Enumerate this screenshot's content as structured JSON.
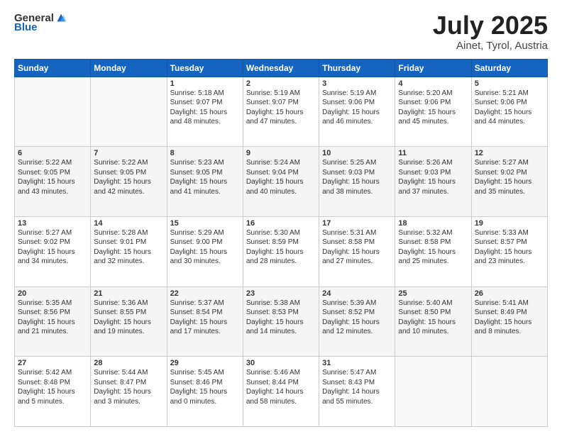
{
  "header": {
    "logo_general": "General",
    "logo_blue": "Blue",
    "title": "July 2025",
    "location": "Ainet, Tyrol, Austria"
  },
  "days_of_week": [
    "Sunday",
    "Monday",
    "Tuesday",
    "Wednesday",
    "Thursday",
    "Friday",
    "Saturday"
  ],
  "weeks": [
    [
      {
        "day": "",
        "info": ""
      },
      {
        "day": "",
        "info": ""
      },
      {
        "day": "1",
        "info": "Sunrise: 5:18 AM\nSunset: 9:07 PM\nDaylight: 15 hours\nand 48 minutes."
      },
      {
        "day": "2",
        "info": "Sunrise: 5:19 AM\nSunset: 9:07 PM\nDaylight: 15 hours\nand 47 minutes."
      },
      {
        "day": "3",
        "info": "Sunrise: 5:19 AM\nSunset: 9:06 PM\nDaylight: 15 hours\nand 46 minutes."
      },
      {
        "day": "4",
        "info": "Sunrise: 5:20 AM\nSunset: 9:06 PM\nDaylight: 15 hours\nand 45 minutes."
      },
      {
        "day": "5",
        "info": "Sunrise: 5:21 AM\nSunset: 9:06 PM\nDaylight: 15 hours\nand 44 minutes."
      }
    ],
    [
      {
        "day": "6",
        "info": "Sunrise: 5:22 AM\nSunset: 9:05 PM\nDaylight: 15 hours\nand 43 minutes."
      },
      {
        "day": "7",
        "info": "Sunrise: 5:22 AM\nSunset: 9:05 PM\nDaylight: 15 hours\nand 42 minutes."
      },
      {
        "day": "8",
        "info": "Sunrise: 5:23 AM\nSunset: 9:05 PM\nDaylight: 15 hours\nand 41 minutes."
      },
      {
        "day": "9",
        "info": "Sunrise: 5:24 AM\nSunset: 9:04 PM\nDaylight: 15 hours\nand 40 minutes."
      },
      {
        "day": "10",
        "info": "Sunrise: 5:25 AM\nSunset: 9:03 PM\nDaylight: 15 hours\nand 38 minutes."
      },
      {
        "day": "11",
        "info": "Sunrise: 5:26 AM\nSunset: 9:03 PM\nDaylight: 15 hours\nand 37 minutes."
      },
      {
        "day": "12",
        "info": "Sunrise: 5:27 AM\nSunset: 9:02 PM\nDaylight: 15 hours\nand 35 minutes."
      }
    ],
    [
      {
        "day": "13",
        "info": "Sunrise: 5:27 AM\nSunset: 9:02 PM\nDaylight: 15 hours\nand 34 minutes."
      },
      {
        "day": "14",
        "info": "Sunrise: 5:28 AM\nSunset: 9:01 PM\nDaylight: 15 hours\nand 32 minutes."
      },
      {
        "day": "15",
        "info": "Sunrise: 5:29 AM\nSunset: 9:00 PM\nDaylight: 15 hours\nand 30 minutes."
      },
      {
        "day": "16",
        "info": "Sunrise: 5:30 AM\nSunset: 8:59 PM\nDaylight: 15 hours\nand 28 minutes."
      },
      {
        "day": "17",
        "info": "Sunrise: 5:31 AM\nSunset: 8:58 PM\nDaylight: 15 hours\nand 27 minutes."
      },
      {
        "day": "18",
        "info": "Sunrise: 5:32 AM\nSunset: 8:58 PM\nDaylight: 15 hours\nand 25 minutes."
      },
      {
        "day": "19",
        "info": "Sunrise: 5:33 AM\nSunset: 8:57 PM\nDaylight: 15 hours\nand 23 minutes."
      }
    ],
    [
      {
        "day": "20",
        "info": "Sunrise: 5:35 AM\nSunset: 8:56 PM\nDaylight: 15 hours\nand 21 minutes."
      },
      {
        "day": "21",
        "info": "Sunrise: 5:36 AM\nSunset: 8:55 PM\nDaylight: 15 hours\nand 19 minutes."
      },
      {
        "day": "22",
        "info": "Sunrise: 5:37 AM\nSunset: 8:54 PM\nDaylight: 15 hours\nand 17 minutes."
      },
      {
        "day": "23",
        "info": "Sunrise: 5:38 AM\nSunset: 8:53 PM\nDaylight: 15 hours\nand 14 minutes."
      },
      {
        "day": "24",
        "info": "Sunrise: 5:39 AM\nSunset: 8:52 PM\nDaylight: 15 hours\nand 12 minutes."
      },
      {
        "day": "25",
        "info": "Sunrise: 5:40 AM\nSunset: 8:50 PM\nDaylight: 15 hours\nand 10 minutes."
      },
      {
        "day": "26",
        "info": "Sunrise: 5:41 AM\nSunset: 8:49 PM\nDaylight: 15 hours\nand 8 minutes."
      }
    ],
    [
      {
        "day": "27",
        "info": "Sunrise: 5:42 AM\nSunset: 8:48 PM\nDaylight: 15 hours\nand 5 minutes."
      },
      {
        "day": "28",
        "info": "Sunrise: 5:44 AM\nSunset: 8:47 PM\nDaylight: 15 hours\nand 3 minutes."
      },
      {
        "day": "29",
        "info": "Sunrise: 5:45 AM\nSunset: 8:46 PM\nDaylight: 15 hours\nand 0 minutes."
      },
      {
        "day": "30",
        "info": "Sunrise: 5:46 AM\nSunset: 8:44 PM\nDaylight: 14 hours\nand 58 minutes."
      },
      {
        "day": "31",
        "info": "Sunrise: 5:47 AM\nSunset: 8:43 PM\nDaylight: 14 hours\nand 55 minutes."
      },
      {
        "day": "",
        "info": ""
      },
      {
        "day": "",
        "info": ""
      }
    ]
  ]
}
